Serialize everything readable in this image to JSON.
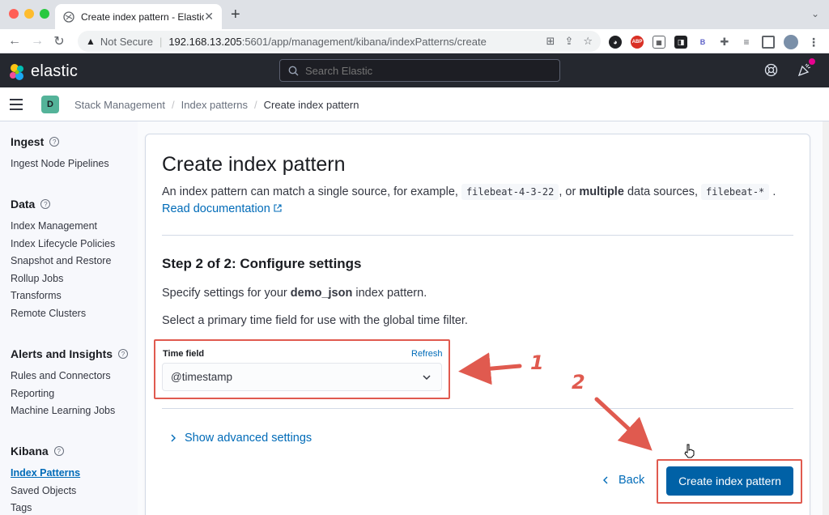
{
  "browser": {
    "tab_title": "Create index pattern - Elastic",
    "not_secure": "Not Secure",
    "url_host": "192.168.13.205",
    "url_path": ":5601/app/management/kibana/indexPatterns/create"
  },
  "header": {
    "brand": "elastic",
    "search_placeholder": "Search Elastic"
  },
  "breadcrumbs": {
    "space_initial": "D",
    "items": [
      "Stack Management",
      "Index patterns",
      "Create index pattern"
    ]
  },
  "sidebar": {
    "groups": [
      {
        "title": "Ingest",
        "items": [
          "Ingest Node Pipelines"
        ]
      },
      {
        "title": "Data",
        "items": [
          "Index Management",
          "Index Lifecycle Policies",
          "Snapshot and Restore",
          "Rollup Jobs",
          "Transforms",
          "Remote Clusters"
        ]
      },
      {
        "title": "Alerts and Insights",
        "items": [
          "Rules and Connectors",
          "Reporting",
          "Machine Learning Jobs"
        ]
      },
      {
        "title": "Kibana",
        "items": [
          "Index Patterns",
          "Saved Objects",
          "Tags"
        ]
      }
    ],
    "help_glyph": "?"
  },
  "main": {
    "title": "Create index pattern",
    "desc_part1": "An index pattern can match a single source, for example,",
    "code1": "filebeat-4-3-22",
    "desc_part2": ", or",
    "desc_bold": "multiple",
    "desc_part3": "data sources,",
    "code2": "filebeat-*",
    "desc_part4": ".",
    "docs_link": "Read documentation",
    "step_title": "Step 2 of 2: Configure settings",
    "specify_pre": "Specify settings for your",
    "specify_bold": "demo_json",
    "specify_post": "index pattern.",
    "select_hint": "Select a primary time field for use with the global time filter.",
    "time_field_label": "Time field",
    "refresh_label": "Refresh",
    "time_field_value": "@timestamp",
    "advanced_label": "Show advanced settings",
    "back_label": "Back",
    "create_label": "Create index pattern"
  },
  "annotations": {
    "label1": "1",
    "label2": "2",
    "color": "#e05a4f"
  }
}
